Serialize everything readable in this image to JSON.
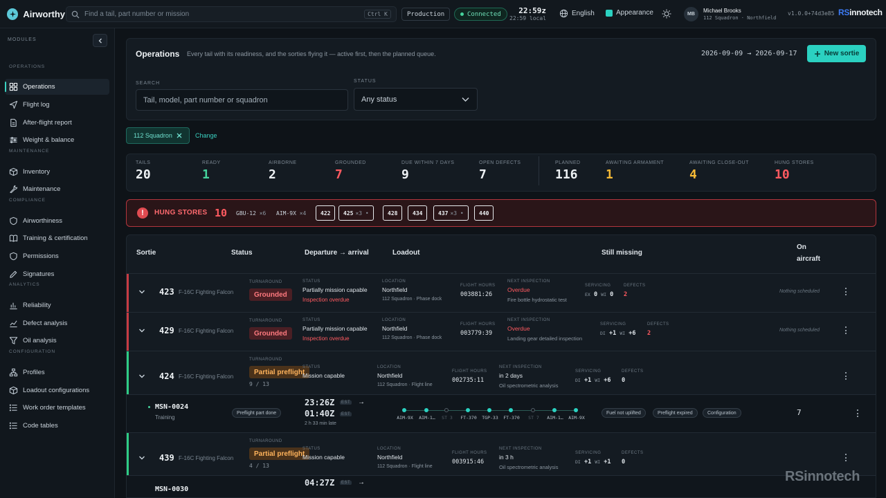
{
  "app": {
    "name": "Airworthy"
  },
  "topbar": {
    "search_placeholder": "Find a tail, part number or mission",
    "search_shortcut": "Ctrl K",
    "environment": "Production",
    "connection": "Connected",
    "clock_zulu": "22:59z",
    "clock_local": "22:59 local",
    "language": "English",
    "appearance": "Appearance",
    "user_initials": "MB",
    "user_name": "Michael Brooks",
    "user_unit": "112 Squadron · Northfield",
    "version": "v1.0.0+74d3e85",
    "brand_rs": "RS",
    "brand_rest": "innotech"
  },
  "sidebar": {
    "header": "MODULES",
    "sections": [
      {
        "label": "OPERATIONS",
        "items": [
          {
            "label": "Operations",
            "icon": "grid-icon",
            "active": true
          },
          {
            "label": "Flight log",
            "icon": "send-icon"
          },
          {
            "label": "After-flight report",
            "icon": "file-icon"
          },
          {
            "label": "Weight & balance",
            "icon": "sliders-icon"
          }
        ]
      },
      {
        "label": "MAINTENANCE",
        "items": [
          {
            "label": "Inventory",
            "icon": "box-icon"
          },
          {
            "label": "Maintenance",
            "icon": "wrench-icon"
          }
        ]
      },
      {
        "label": "COMPLIANCE",
        "items": [
          {
            "label": "Airworthiness",
            "icon": "shield-icon"
          },
          {
            "label": "Training & certification",
            "icon": "book-icon"
          },
          {
            "label": "Permissions",
            "icon": "shield-icon"
          },
          {
            "label": "Signatures",
            "icon": "pen-icon"
          }
        ]
      },
      {
        "label": "ANALYTICS",
        "items": [
          {
            "label": "Reliability",
            "icon": "bar-chart-icon"
          },
          {
            "label": "Defect analysis",
            "icon": "trend-icon"
          },
          {
            "label": "Oil analysis",
            "icon": "filter-icon"
          }
        ]
      },
      {
        "label": "CONFIGURATION",
        "items": [
          {
            "label": "Profiles",
            "icon": "sitemap-icon"
          },
          {
            "label": "Loadout configurations",
            "icon": "box-icon"
          },
          {
            "label": "Work order templates",
            "icon": "list-icon"
          },
          {
            "label": "Code tables",
            "icon": "list-icon"
          }
        ]
      }
    ]
  },
  "operations": {
    "title": "Operations",
    "description": "Every tail with its readiness, and the sorties flying it — active first, then the planned queue.",
    "date_range": "2026-09-09 → 2026-09-17",
    "new_sortie": "New sortie",
    "search_label": "SEARCH",
    "search_placeholder": "Tail, model, part number or squadron",
    "status_label": "STATUS",
    "status_value": "Any status",
    "filter_chip": "112 Squadron",
    "change": "Change"
  },
  "kpis": [
    {
      "label": "TAILS",
      "value": "20",
      "color": "#eef2f5"
    },
    {
      "label": "READY",
      "value": "1",
      "color": "#45d39c"
    },
    {
      "label": "AIRBORNE",
      "value": "2",
      "color": "#eef2f5"
    },
    {
      "label": "GROUNDED",
      "value": "7",
      "color": "#ff5a60"
    },
    {
      "label": "DUE WITHIN 7 DAYS",
      "value": "9",
      "color": "#eef2f5"
    },
    {
      "label": "OPEN DEFECTS",
      "value": "7",
      "color": "#eef2f5"
    },
    {
      "label": "PLANNED",
      "value": "116",
      "color": "#eef2f5"
    },
    {
      "label": "AWAITING ARMAMENT",
      "value": "1",
      "color": "#f5b935"
    },
    {
      "label": "AWAITING CLOSE-OUT",
      "value": "4",
      "color": "#f5b935"
    },
    {
      "label": "HUNG STORES",
      "value": "10",
      "color": "#ff5a60"
    }
  ],
  "hung_stores": {
    "title": "HUNG STORES",
    "count": "10",
    "stores": [
      {
        "name": "GBU-12",
        "qty": "×6"
      },
      {
        "name": "AIM-9X",
        "qty": "×4"
      }
    ],
    "tails": [
      {
        "tail": "422",
        "extra": ""
      },
      {
        "tail": "425",
        "extra": "×3 •"
      },
      {
        "tail": "428",
        "extra": ""
      },
      {
        "tail": "434",
        "extra": ""
      },
      {
        "tail": "437",
        "extra": "×3 •"
      },
      {
        "tail": "440",
        "extra": ""
      }
    ]
  },
  "table": {
    "headers": {
      "sortie": "Sortie",
      "status": "Status",
      "departure": "Departure → arrival",
      "loadout": "Loadout",
      "missing": "Still missing",
      "on_aircraft_1": "On",
      "on_aircraft_2": "aircraft"
    },
    "labels": {
      "turnaround": "TURNAROUND",
      "status": "STATUS",
      "location": "LOCATION",
      "flight_hours": "FLIGHT HOURS",
      "next_inspection": "NEXT INSPECTION",
      "servicing": "SERVICING",
      "defects": "DEFECTS"
    },
    "rows": [
      {
        "tail": "423",
        "model": "F-16C Fighting Falcon",
        "turnaround": "Grounded",
        "status": "Partially mission capable",
        "status_sub": "Inspection overdue",
        "location": "Northfield",
        "location_sub": "112 Squadron · Phase dock",
        "hours": "003881:26",
        "next": "Overdue",
        "next_sub": "Fire bottle hydrostatic test",
        "serv_ex": "EX",
        "serv_ex_v": "0",
        "serv_wi": "WI",
        "serv_wi_v": "0",
        "defects": "2",
        "scheduled": "Nothing scheduled"
      },
      {
        "tail": "429",
        "model": "F-16C Fighting Falcon",
        "turnaround": "Grounded",
        "status": "Partially mission capable",
        "status_sub": "Inspection overdue",
        "location": "Northfield",
        "location_sub": "112 Squadron · Phase dock",
        "hours": "003779:39",
        "next": "Overdue",
        "next_sub": "Landing gear detailed inspection",
        "serv_ex": "DI",
        "serv_ex_v": "+1",
        "serv_wi": "WI",
        "serv_wi_v": "+6",
        "defects": "2",
        "scheduled": "Nothing scheduled"
      },
      {
        "tail": "424",
        "model": "F-16C Fighting Falcon",
        "turnaround": "Partial preflight",
        "progress": "9 / 13",
        "status": "Mission capable",
        "location": "Northfield",
        "location_sub": "112 Squadron · Flight line",
        "hours": "002735:11",
        "next": "in 2 days",
        "next_sub": "Oil spectrometric analysis",
        "serv_ex": "DI",
        "serv_ex_v": "+1",
        "serv_wi": "WI",
        "serv_wi_v": "+6",
        "defects": "0"
      },
      {
        "tail": "439",
        "model": "F-16C Fighting Falcon",
        "turnaround": "Partial preflight",
        "progress": "4 / 13",
        "status": "Mission capable",
        "location": "Northfield",
        "location_sub": "112 Squadron · Flight line",
        "hours": "003915:46",
        "next": "in 3 h",
        "next_sub": "Oil spectrometric analysis",
        "serv_ex": "DI",
        "serv_ex_v": "+1",
        "serv_wi": "WI",
        "serv_wi_v": "+1",
        "defects": "0"
      }
    ],
    "missions": [
      {
        "id": "MSN-0024",
        "type": "Training",
        "state": "Preflight part done",
        "dep": "23:26Z",
        "dep_tag": "EST",
        "arr": "01:40Z",
        "arr_tag": "EST",
        "late": "2 h 33 min late",
        "loadout": [
          "AIM-9X",
          "AIM-1…",
          "ST 3",
          "FT-370",
          "TGP-33",
          "FT-370",
          "ST 7",
          "AIM-1…",
          "AIM-9X"
        ],
        "missing": [
          "Fuel not uplifted",
          "Preflight expired",
          "Configuration"
        ],
        "on_aircraft": "7"
      },
      {
        "id": "MSN-0030",
        "dep": "04:27Z",
        "dep_tag": "EST"
      }
    ]
  },
  "watermark": "RSinnotech"
}
